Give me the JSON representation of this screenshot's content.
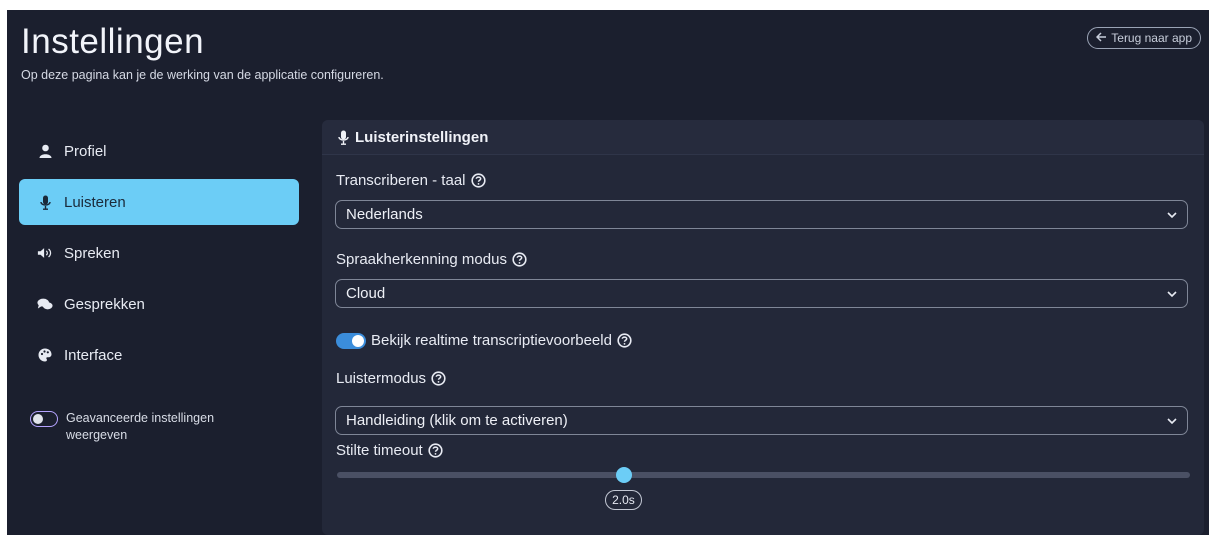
{
  "header": {
    "title": "Instellingen",
    "subtitle": "Op deze pagina kan je de werking van de applicatie configureren.",
    "back_button": "Terug naar app"
  },
  "sidebar": {
    "items": [
      {
        "label": "Profiel",
        "icon": "user-icon",
        "active": false
      },
      {
        "label": "Luisteren",
        "icon": "microphone-icon",
        "active": true
      },
      {
        "label": "Spreken",
        "icon": "speaker-icon",
        "active": false
      },
      {
        "label": "Gesprekken",
        "icon": "chat-icon",
        "active": false
      },
      {
        "label": "Interface",
        "icon": "palette-icon",
        "active": false
      }
    ],
    "advanced_toggle": {
      "label": "Geavanceerde instellingen weergeven",
      "on": false
    }
  },
  "panel": {
    "title": "Luisterinstellingen",
    "transcribe_language": {
      "label": "Transcriberen - taal",
      "value": "Nederlands"
    },
    "recognition_mode": {
      "label": "Spraakherkenning modus",
      "value": "Cloud"
    },
    "realtime_preview": {
      "label": "Bekijk realtime transcriptievoorbeeld",
      "on": true
    },
    "listen_mode": {
      "label": "Luistermodus",
      "value": "Handleiding (klik om te activeren)"
    },
    "silence_timeout": {
      "label": "Stilte timeout",
      "value_label": "2.0s",
      "fraction": 0.336
    }
  },
  "colors": {
    "background": "#1b1f2e",
    "panel": "#232839",
    "accent": "#6ccdf6",
    "toggle_on": "#3b8ddb"
  }
}
